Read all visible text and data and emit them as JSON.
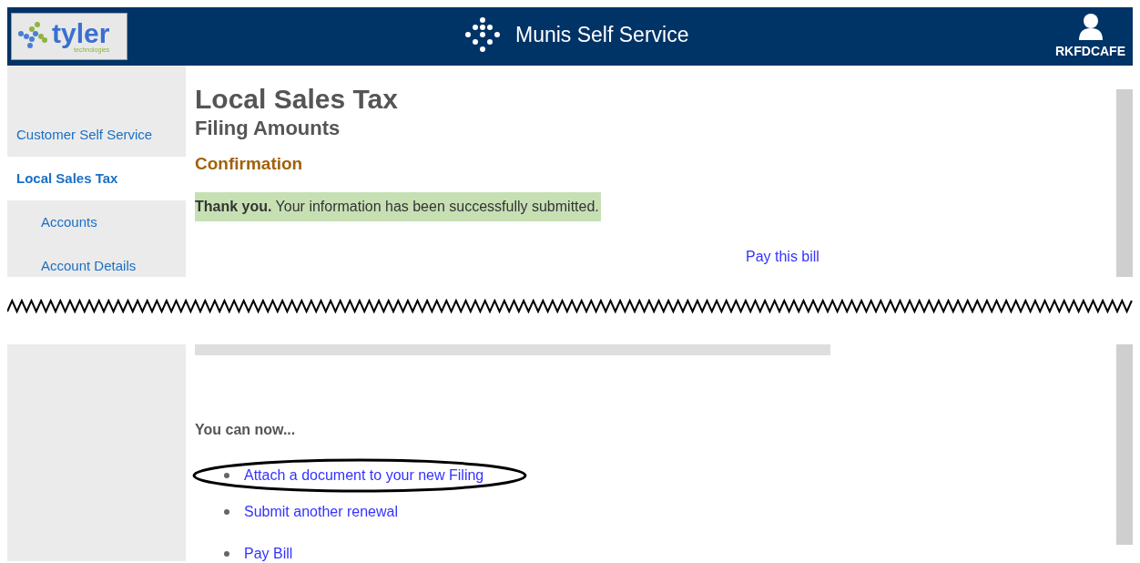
{
  "header": {
    "logo_text": "tyler",
    "logo_subtext": "technologies",
    "app_title": "Munis Self Service",
    "user": "RKFDCAFE"
  },
  "sidebar": {
    "items": [
      {
        "label": "Customer Self Service",
        "selected": false
      },
      {
        "label": "Local Sales Tax",
        "selected": true,
        "children": [
          {
            "label": "Accounts",
            "selected": false
          },
          {
            "label": "Account Details",
            "selected": false
          }
        ]
      }
    ]
  },
  "page": {
    "title": "Local Sales Tax",
    "subtitle": "Filing Amounts",
    "section": "Confirmation",
    "message": "**Thank you.** Your information has been successfully submitted.",
    "pay_link": "Pay this bill"
  },
  "next_steps": {
    "heading": "You can now...",
    "links": [
      {
        "label": "Attach a document to your new Filing",
        "circled": true
      },
      {
        "label": "Submit another renewal",
        "circled": false
      },
      {
        "label": "Pay Bill",
        "circled": false
      }
    ]
  }
}
